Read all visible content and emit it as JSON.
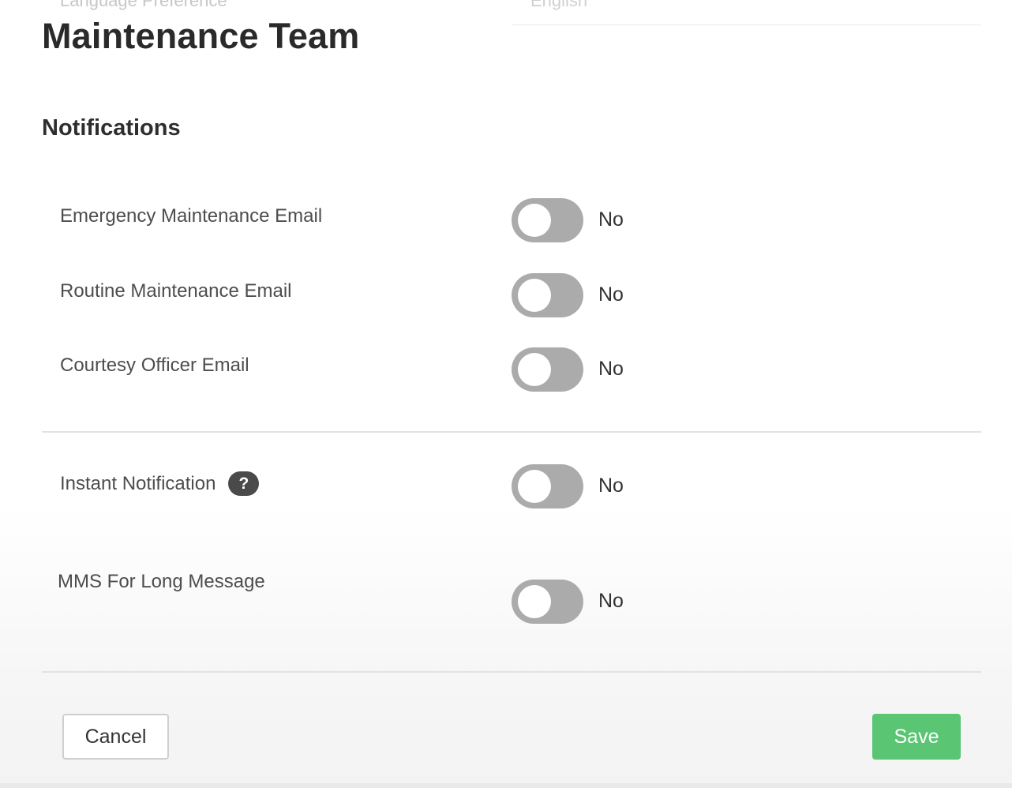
{
  "top_cutoff": {
    "label": "Language Preference",
    "value": "English"
  },
  "page_title": "Maintenance Team",
  "notifications": {
    "section_title": "Notifications",
    "email_rows": [
      {
        "label": "Emergency Maintenance Email",
        "state": "No",
        "enabled": false
      },
      {
        "label": "Routine Maintenance Email",
        "state": "No",
        "enabled": false
      },
      {
        "label": "Courtesy Officer Email",
        "state": "No",
        "enabled": false
      }
    ],
    "instant_notification": {
      "label": "Instant Notification",
      "help_icon": "question-mark-icon",
      "help_glyph": "?",
      "state": "No",
      "enabled": false
    },
    "mms_long_message": {
      "label": "MMS For Long Message",
      "state": "No",
      "enabled": false
    }
  },
  "footer": {
    "cancel_label": "Cancel",
    "save_label": "Save"
  },
  "colors": {
    "toggle_off": "#ababab",
    "save_button": "#5ac572",
    "help_icon_bg": "#4a4a4a"
  }
}
